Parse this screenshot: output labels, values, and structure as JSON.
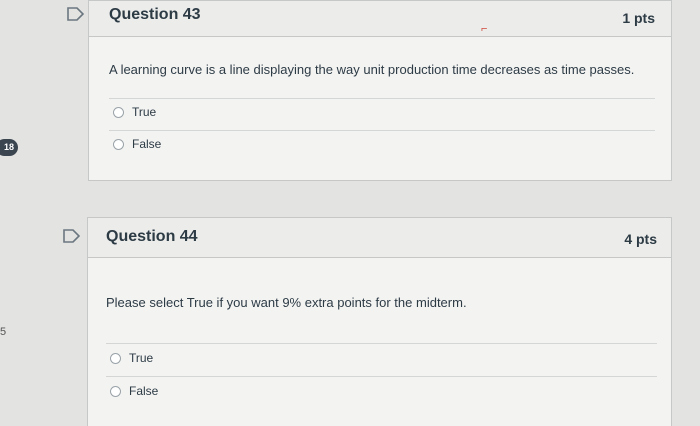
{
  "sidebar_badge": "18",
  "edge_mark": "5",
  "questions": [
    {
      "title": "Question 43",
      "points": "1 pts",
      "text": "A learning curve is a line displaying the way unit production time decreases as time passes.",
      "answers": [
        "True",
        "False"
      ]
    },
    {
      "title": "Question 44",
      "points": "4 pts",
      "text": "Please select True if you want 9% extra points for the midterm.",
      "answers": [
        "True",
        "False"
      ]
    }
  ],
  "colors": {
    "page_bg": "#e3e3e1",
    "card_bg": "#f3f3f2",
    "header_bg": "#ececeb",
    "text": "#2d3b45",
    "badge_bg": "#3b4550"
  }
}
